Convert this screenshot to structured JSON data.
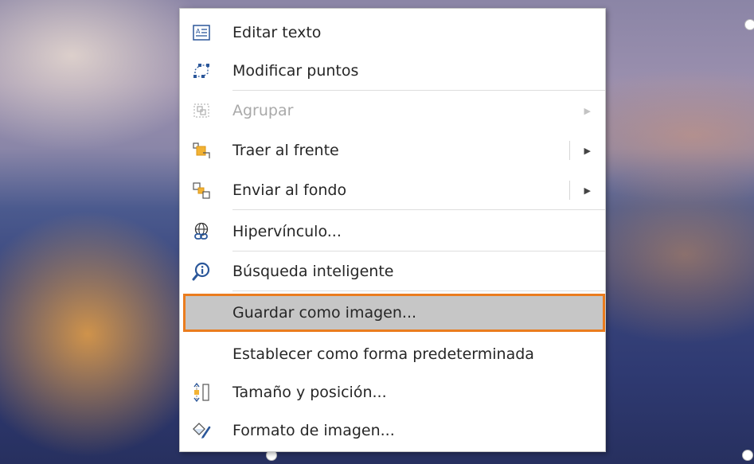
{
  "menu": {
    "items": [
      {
        "label": "Editar texto",
        "icon": "edit-text-icon"
      },
      {
        "label": "Modificar puntos",
        "icon": "edit-points-icon"
      },
      {
        "label": "Agrupar",
        "icon": "group-icon",
        "disabled": true,
        "submenu": true
      },
      {
        "label": "Traer al frente",
        "icon": "bring-to-front-icon",
        "submenu": true
      },
      {
        "label": "Enviar al fondo",
        "icon": "send-to-back-icon",
        "submenu": true
      },
      {
        "label": "Hipervínculo...",
        "icon": "hyperlink-icon"
      },
      {
        "label": "Búsqueda inteligente",
        "icon": "smart-lookup-icon"
      },
      {
        "label": "Guardar como imagen...",
        "icon": "",
        "highlighted": true
      },
      {
        "label": "Establecer como forma predeterminada",
        "icon": ""
      },
      {
        "label": "Tamaño y posición...",
        "icon": "size-position-icon"
      },
      {
        "label": "Formato de imagen...",
        "icon": "format-picture-icon"
      }
    ]
  },
  "colors": {
    "highlight_border": "#ea7c1e",
    "highlight_fill": "#c6c6c6",
    "accent_blue": "#2b579a"
  }
}
